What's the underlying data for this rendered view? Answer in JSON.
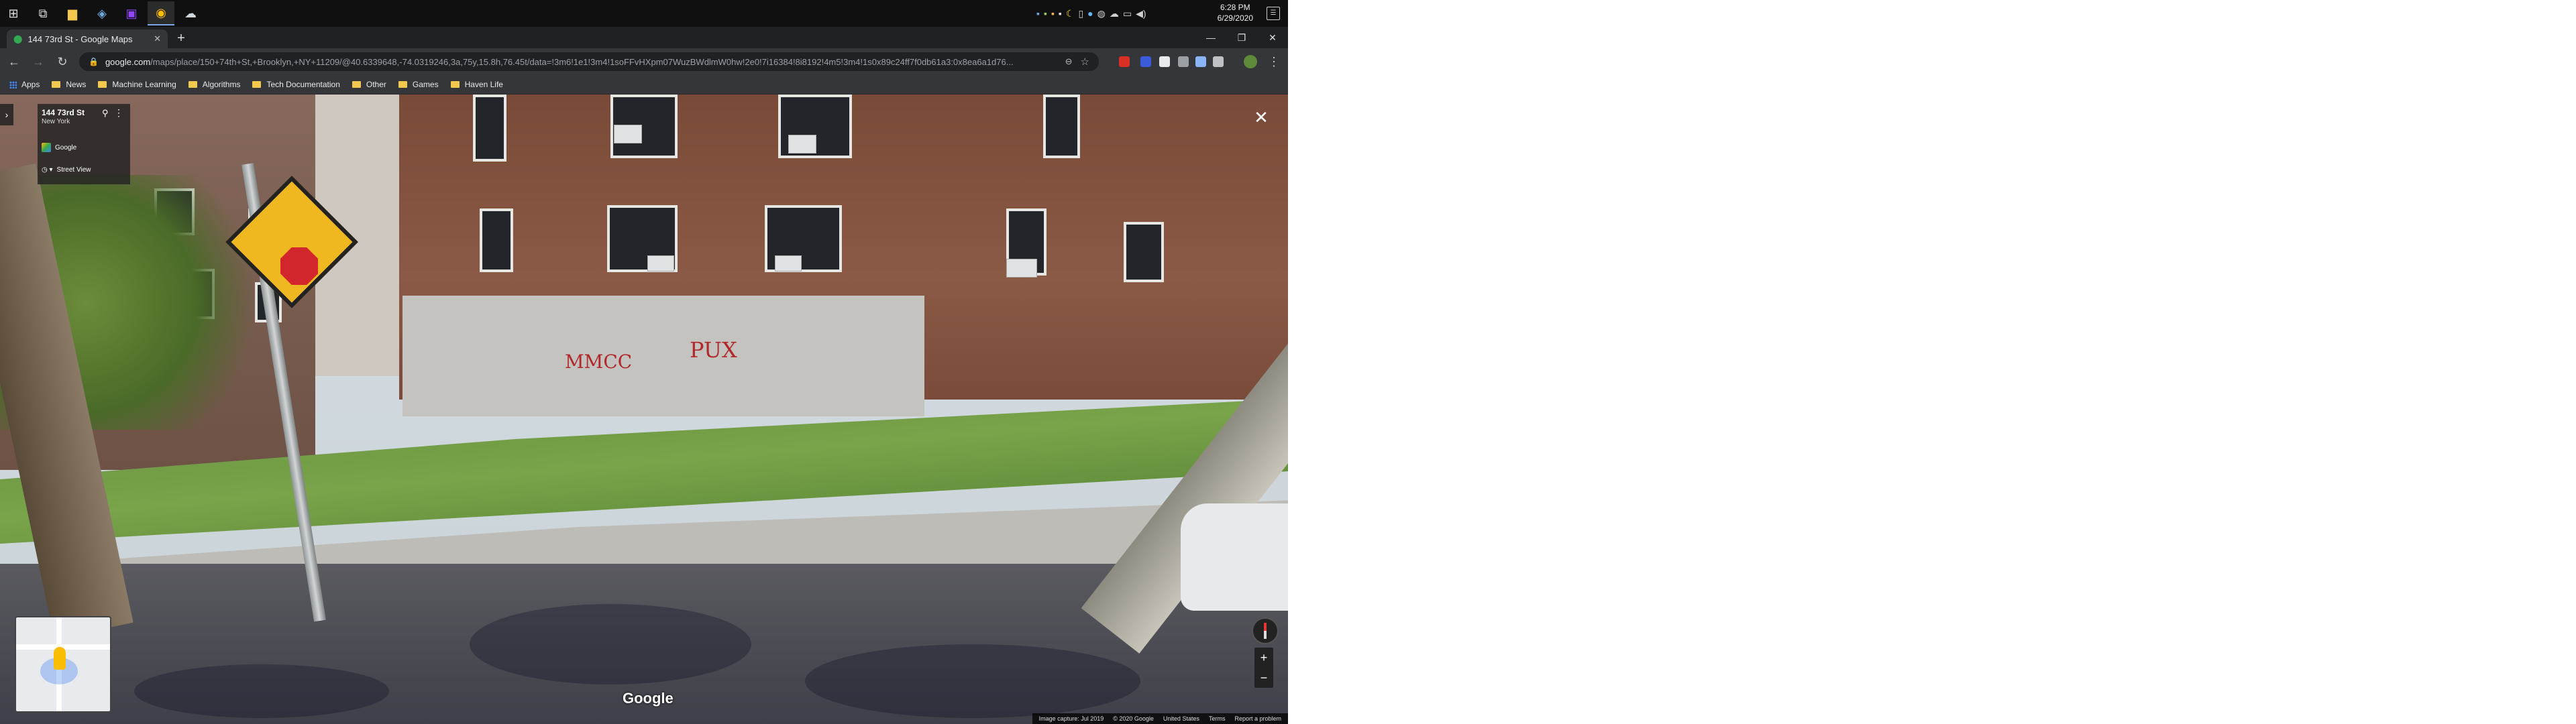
{
  "taskbar": {
    "apps": [
      {
        "name": "windows-start-icon",
        "glyph": "⊞"
      },
      {
        "name": "task-view-icon",
        "glyph": "⧉"
      },
      {
        "name": "file-explorer-icon",
        "glyph": "📁"
      },
      {
        "name": "terminal-icon",
        "glyph": "⌘"
      },
      {
        "name": "twitch-icon",
        "glyph": "▣"
      },
      {
        "name": "chrome-icon",
        "glyph": "◉"
      },
      {
        "name": "cloud-app-icon",
        "glyph": "☁"
      }
    ],
    "clock_time": "6:28 PM",
    "clock_date": "6/29/2020"
  },
  "browser": {
    "tab_title": "144 73rd St - Google Maps",
    "url_host": "google.com",
    "url_path": "/maps/place/150+74th+St,+Brooklyn,+NY+11209/@40.6339648,-74.0319246,3a,75y,15.8h,76.45t/data=!3m6!1e1!3m4!1soFFvHXpm07WuzBWdlmW0hw!2e0!7i16384!8i8192!4m5!3m4!1s0x89c24ff7f0db61a3:0x8ea6a1d76...",
    "bookmarks": [
      "Apps",
      "News",
      "Machine Learning",
      "Algorithms",
      "Tech Documentation",
      "Other",
      "Games",
      "Haven Life"
    ]
  },
  "streetview": {
    "place_title": "144 73rd St",
    "place_subtitle": "New York",
    "provider": "Google",
    "street_view_label": "Street View",
    "watermark": "Google",
    "graffiti_1": "MMCC",
    "graffiti_2": "PUX",
    "footer": {
      "capture": "Image capture: Jul 2019",
      "copyright": "© 2020 Google",
      "region": "United States",
      "terms": "Terms",
      "report": "Report a problem"
    }
  },
  "colors": {
    "accent": "#4285f4",
    "sign_yellow": "#f0b820",
    "stop_red": "#d3262c"
  }
}
